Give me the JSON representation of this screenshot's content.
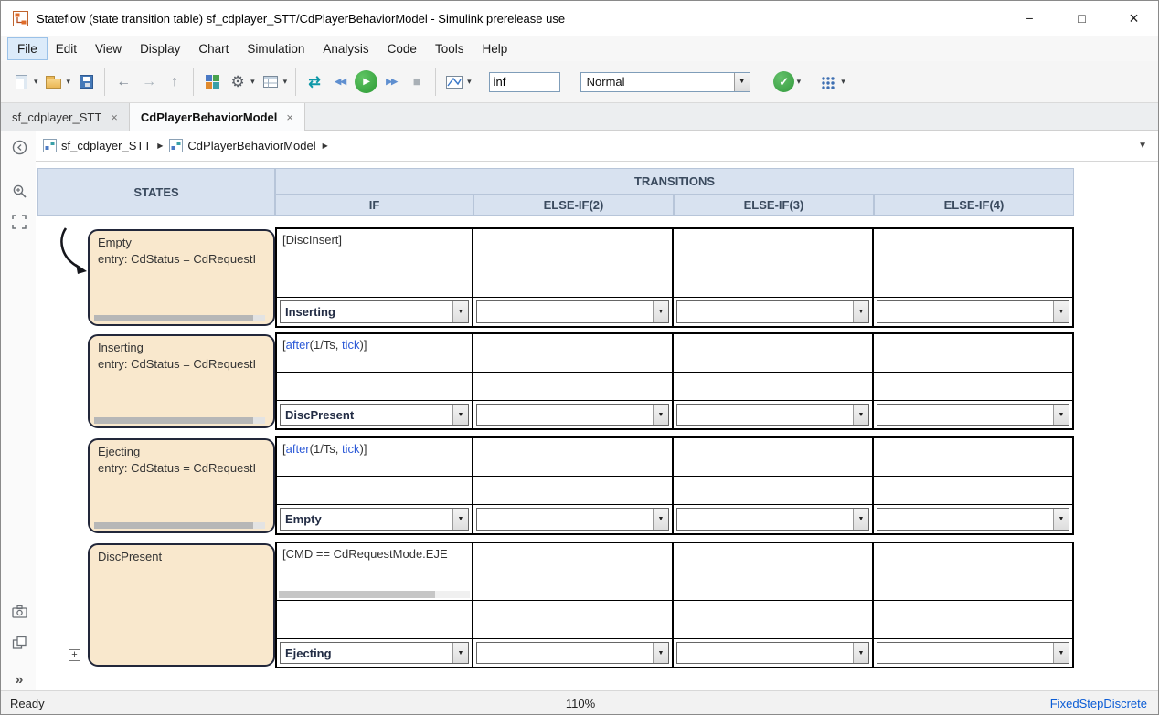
{
  "colors": {
    "keyword_blue": "#2e5bd7",
    "state_fill": "#f9e8cd",
    "state_border": "#22273a",
    "header_bg": "#d8e2f0",
    "header_border": "#b7c5d9",
    "header_text": "#3a4a5e",
    "cell_border": "#000000",
    "link_blue": "#0b5cd5",
    "run_green": "#2fa23c"
  },
  "window": {
    "title": "Stateflow (state transition table) sf_cdplayer_STT/CdPlayerBehaviorModel - Simulink prerelease use",
    "controls": {
      "minimize": "−",
      "maximize": "□",
      "close": "×"
    }
  },
  "menu": {
    "items": [
      "File",
      "Edit",
      "View",
      "Display",
      "Chart",
      "Simulation",
      "Analysis",
      "Code",
      "Tools",
      "Help"
    ]
  },
  "toolbar": {
    "stop_time_value": "inf",
    "mode_value": "Normal"
  },
  "icons": {
    "back": "←",
    "forward": "→",
    "up": "↑",
    "gear": "⚙",
    "refresh": "⇄",
    "step_back": "◀◀",
    "run": "▶",
    "step_forward": "▶▶",
    "stop": "■",
    "advisor_check": "✓",
    "dropdown_caret": "▾",
    "combo_caret": "▼",
    "crumb_arrow": "▶",
    "breadcrumb_expand": "▼",
    "tab_close": "×",
    "more_tools": "»",
    "expand_plus": "+"
  },
  "tabs": [
    {
      "label": "sf_cdplayer_STT"
    },
    {
      "label": "CdPlayerBehaviorModel"
    }
  ],
  "breadcrumb": {
    "items": [
      "sf_cdplayer_STT",
      "CdPlayerBehaviorModel"
    ]
  },
  "table": {
    "states_header": "STATES",
    "transitions_header": "TRANSITIONS",
    "transition_columns": [
      "IF",
      "ELSE-IF(2)",
      "ELSE-IF(3)",
      "ELSE-IF(4)"
    ],
    "rows": [
      {
        "state": {
          "name": "Empty",
          "entry": "entry: CdStatus = CdRequestI"
        },
        "if": {
          "condition_parts": [
            {
              "text": "[DiscInsert]",
              "keyword": false
            }
          ],
          "destination": "Inserting"
        }
      },
      {
        "state": {
          "name": "Inserting",
          "entry": "entry: CdStatus = CdRequestI"
        },
        "if": {
          "condition_parts": [
            {
              "text": "[",
              "keyword": false
            },
            {
              "text": "after",
              "keyword": true
            },
            {
              "text": "(1/Ts, ",
              "keyword": false
            },
            {
              "text": "tick",
              "keyword": true
            },
            {
              "text": ")]",
              "keyword": false
            }
          ],
          "destination": "DiscPresent"
        }
      },
      {
        "state": {
          "name": "Ejecting",
          "entry": "entry: CdStatus = CdRequestI"
        },
        "if": {
          "condition_parts": [
            {
              "text": "[",
              "keyword": false
            },
            {
              "text": "after",
              "keyword": true
            },
            {
              "text": "(1/Ts, ",
              "keyword": false
            },
            {
              "text": "tick",
              "keyword": true
            },
            {
              "text": ")]",
              "keyword": false
            }
          ],
          "destination": "Empty"
        }
      },
      {
        "state": {
          "name": "DiscPresent",
          "entry": ""
        },
        "if": {
          "condition_parts": [
            {
              "text": "[CMD == CdRequestMode.EJE",
              "keyword": false
            }
          ],
          "destination": "Ejecting"
        }
      }
    ]
  },
  "statusbar": {
    "ready": "Ready",
    "zoom": "110%",
    "solver": "FixedStepDiscrete"
  }
}
